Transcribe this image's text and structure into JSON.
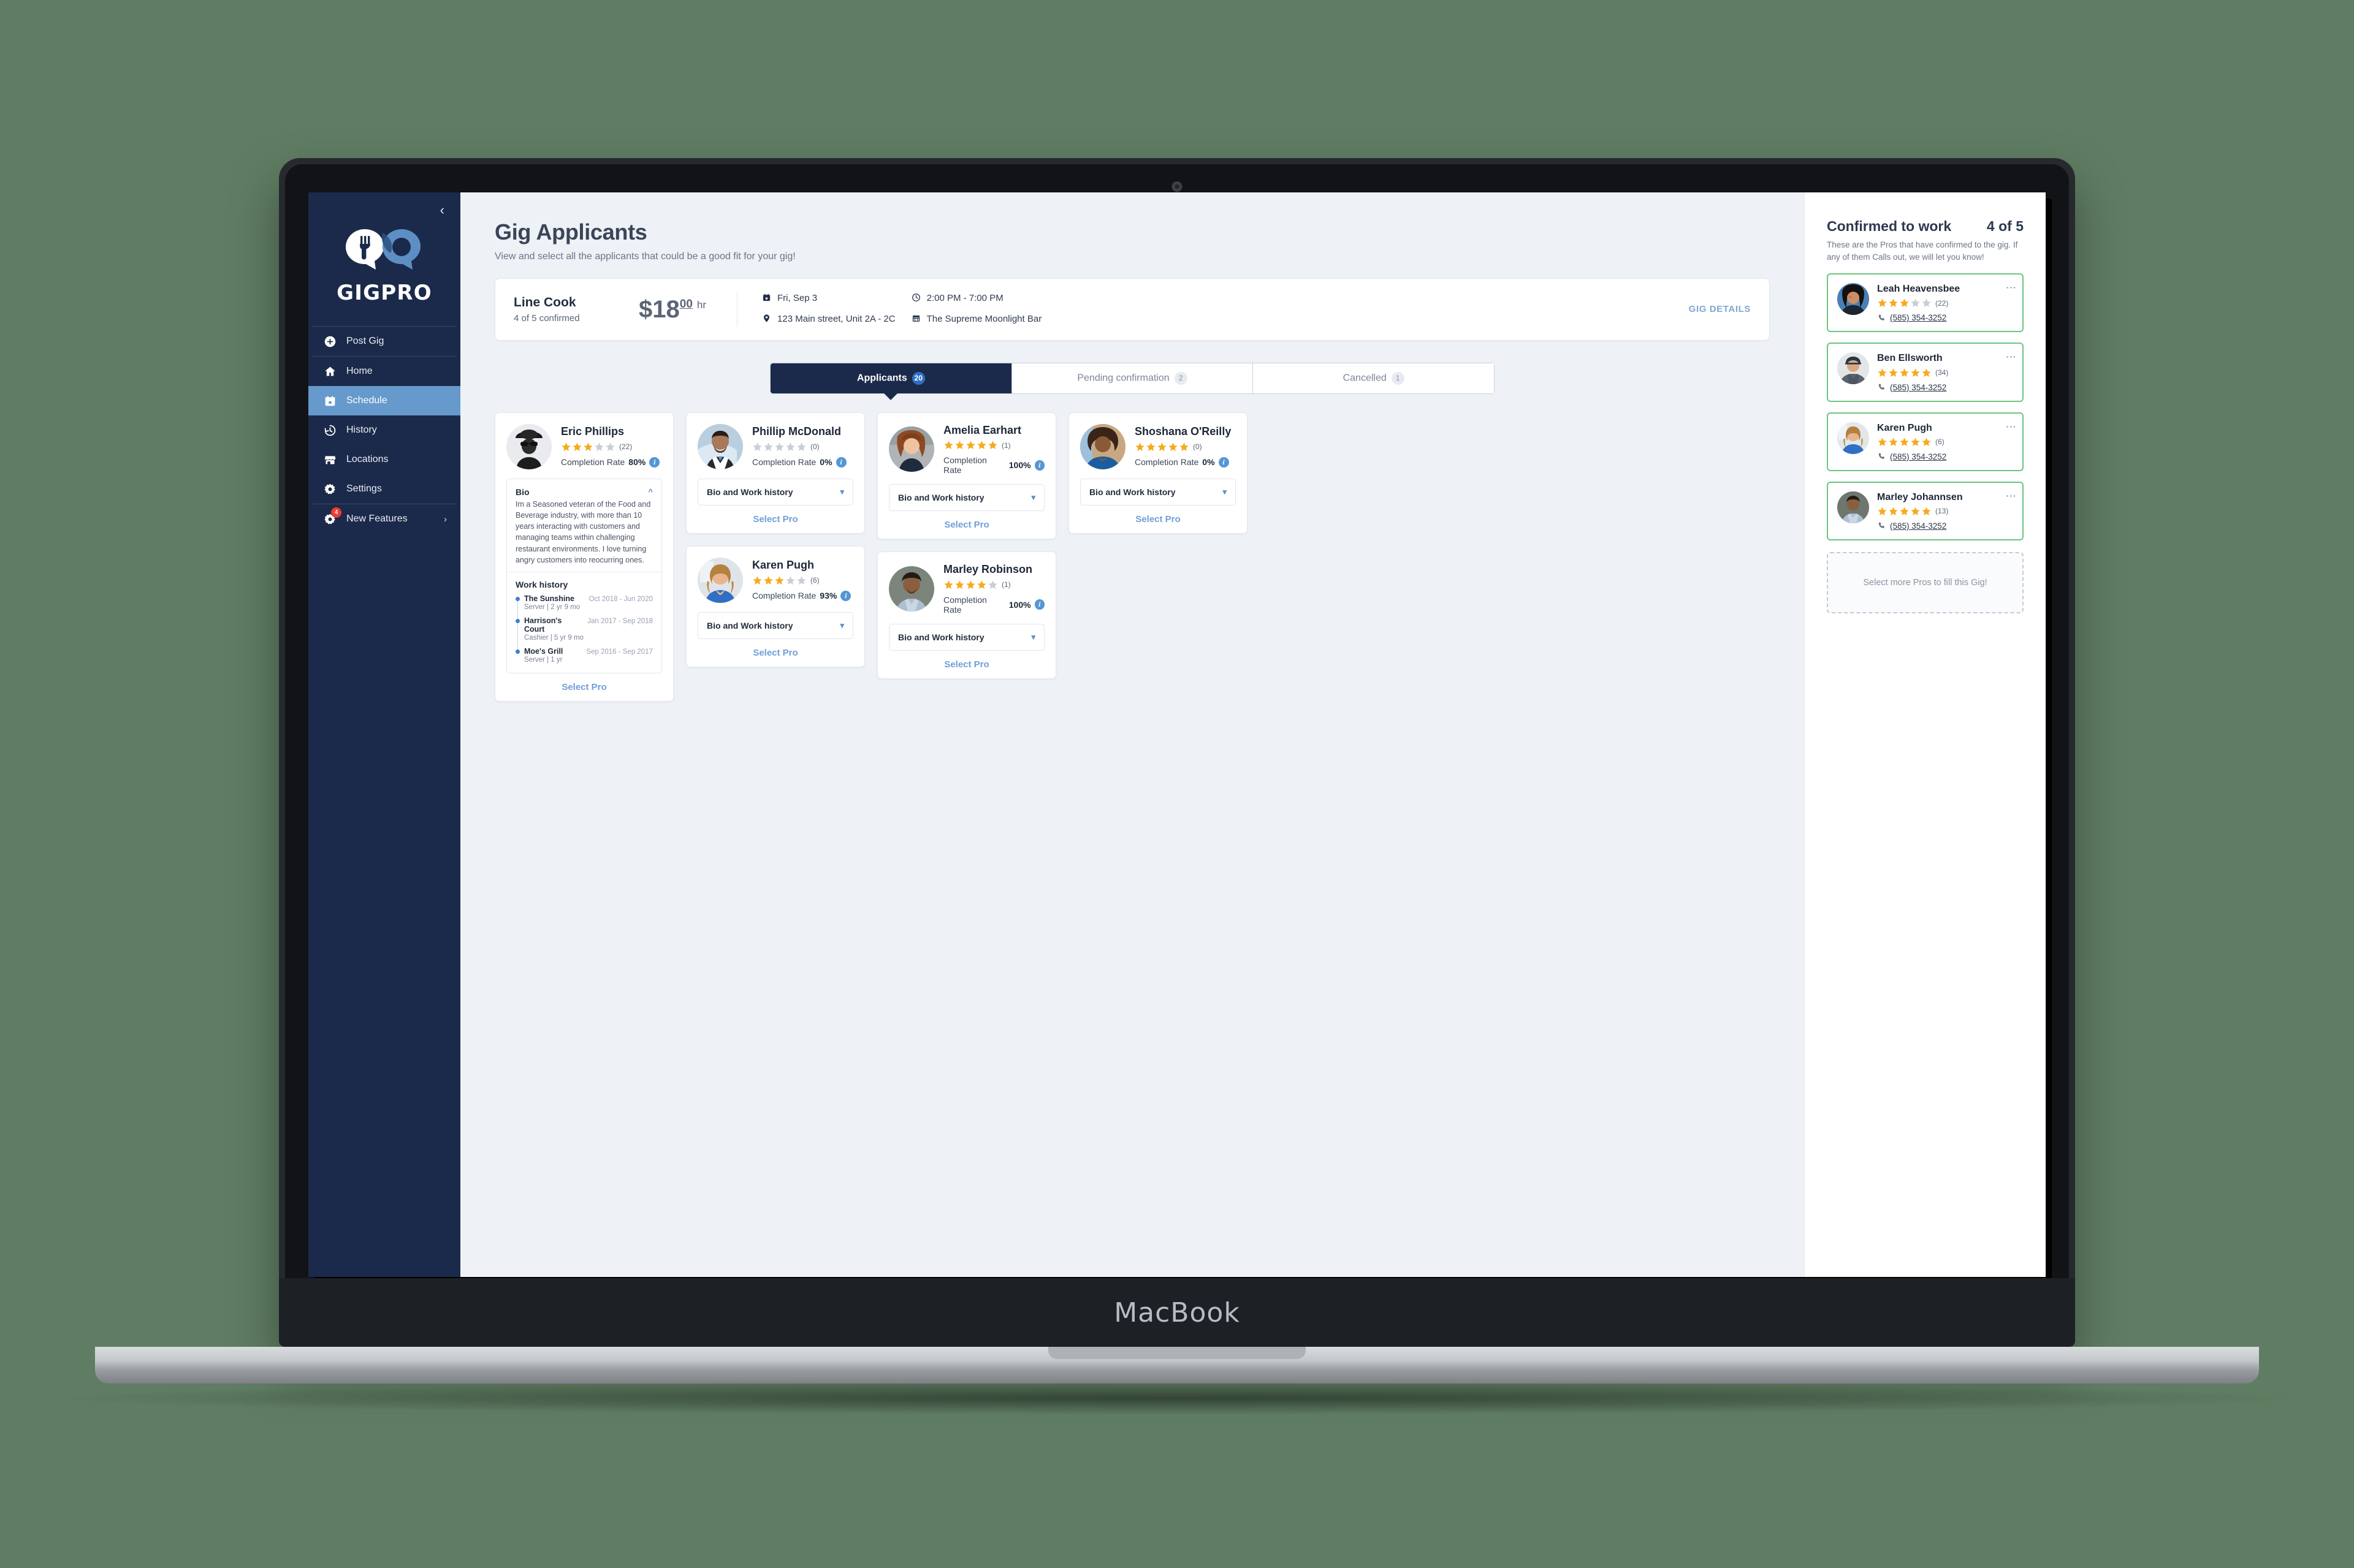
{
  "device": {
    "label": "MacBook"
  },
  "sidebar": {
    "brand": "GIGPRO",
    "collapse_icon": "chevron-left-icon",
    "items": [
      {
        "label": "Post Gig",
        "icon": "plus-circle-icon",
        "active": false,
        "badge": "",
        "chevron": ""
      },
      {
        "label": "Home",
        "icon": "home-icon",
        "active": false,
        "badge": "",
        "chevron": ""
      },
      {
        "label": "Schedule",
        "icon": "calendar-icon",
        "active": true,
        "badge": "",
        "chevron": ""
      },
      {
        "label": "History",
        "icon": "clock-history-icon",
        "active": false,
        "badge": "",
        "chevron": ""
      },
      {
        "label": "Locations",
        "icon": "store-icon",
        "active": false,
        "badge": "",
        "chevron": ""
      },
      {
        "label": "Settings",
        "icon": "gear-icon",
        "active": false,
        "badge": "",
        "chevron": ""
      },
      {
        "label": "New Features",
        "icon": "gear-sparkle-icon",
        "active": false,
        "badge": "4",
        "chevron": "›"
      }
    ]
  },
  "main": {
    "title": "Gig Applicants",
    "subtitle": "View and select all the applicants that could be a good fit for your gig!",
    "gig": {
      "role": "Line Cook",
      "confirmed": "4 of 5 confirmed",
      "rate_dollars": "$18",
      "rate_cents": "00",
      "rate_per": "hr",
      "date": "Fri, Sep 3",
      "address": "123 Main street, Unit 2A - 2C",
      "time": "2:00 PM - 7:00 PM",
      "venue": "The Supreme Moonlight Bar",
      "details_link": "GIG DETAILS"
    },
    "tabs": [
      {
        "label": "Applicants",
        "count": "20",
        "active": true
      },
      {
        "label": "Pending confirmation",
        "count": "2",
        "active": false
      },
      {
        "label": "Cancelled",
        "count": "1",
        "active": false
      }
    ],
    "accordion_label": "Bio and Work history",
    "select_pro_label": "Select Pro",
    "completion_label": "Completion Rate",
    "applicants": [
      {
        "name": "Eric Phillips",
        "stars": 3,
        "reviews": "(22)",
        "completion": "80%",
        "expanded": true,
        "bio_title": "Bio",
        "bio": "Im a Seasoned veteran of the Food and Beverage industry, with more than 10 years interacting with customers and managing teams within challenging restaurant environments. I love turning angry customers into reocurring ones.",
        "work_title": "Work history",
        "work": [
          {
            "place": "The Sunshine",
            "dates": "Oct 2018 - Jun 2020",
            "role": "Server | 2 yr 9 mo"
          },
          {
            "place": "Harrison's Court",
            "dates": "Jan 2017 - Sep 2018",
            "role": "Cashier | 5 yr 9 mo"
          },
          {
            "place": "Moe's Grill",
            "dates": "Sep 2016 - Sep 2017",
            "role": "Server | 1 yr"
          }
        ],
        "avatar": "man-hat-sunglasses"
      },
      {
        "name": "Phillip McDonald",
        "stars": 0,
        "reviews": "(0)",
        "completion": "0%",
        "expanded": false,
        "avatar": "man-suit-beard"
      },
      {
        "name": "Karen Pugh",
        "stars": 3,
        "reviews": "(6)",
        "completion": "93%",
        "expanded": false,
        "avatar": "woman-blonde"
      },
      {
        "name": "Amelia Earhart",
        "stars": 5,
        "reviews": "(1)",
        "completion": "100%",
        "expanded": false,
        "avatar": "woman-auburn"
      },
      {
        "name": "Marley Robinson",
        "stars": 4,
        "reviews": "(1)",
        "completion": "100%",
        "expanded": false,
        "avatar": "man-smiling"
      },
      {
        "name": "Shoshana O'Reilly",
        "stars": 5,
        "reviews": "(0)",
        "completion": "0%",
        "expanded": false,
        "avatar": "woman-curly"
      }
    ]
  },
  "right_panel": {
    "title": "Confirmed to work",
    "count": "4 of 5",
    "subtitle": "These are the Pros that have confirmed to the gig. If any of them Calls out, we will let you know!",
    "placeholder": "Select more Pros to fill this Gig!",
    "pros": [
      {
        "name": "Leah Heavensbee",
        "stars": 3,
        "reviews": "(22)",
        "phone": "(585) 354-3252",
        "avatar": "woman-dark-hair"
      },
      {
        "name": "Ben Ellsworth",
        "stars": 5,
        "reviews": "(34)",
        "phone": "(585) 354-3252",
        "avatar": "man-cap"
      },
      {
        "name": "Karen Pugh",
        "stars": 5,
        "reviews": "(6)",
        "phone": "(585) 354-3252",
        "avatar": "woman-blonde"
      },
      {
        "name": "Marley Johannsen",
        "stars": 5,
        "reviews": "(13)",
        "phone": "(585) 354-3252",
        "avatar": "man-smiling"
      }
    ]
  },
  "colors": {
    "sidebar_bg": "#1b2a4a",
    "sidebar_active": "#6699cc",
    "accent_blue": "#5b8fd0",
    "star_gold": "#f5ab20",
    "star_gray": "#c8cdd6",
    "confirm_green": "#6cc47f",
    "page_bg": "#eef1f5",
    "badge_red": "#ef3b33"
  }
}
